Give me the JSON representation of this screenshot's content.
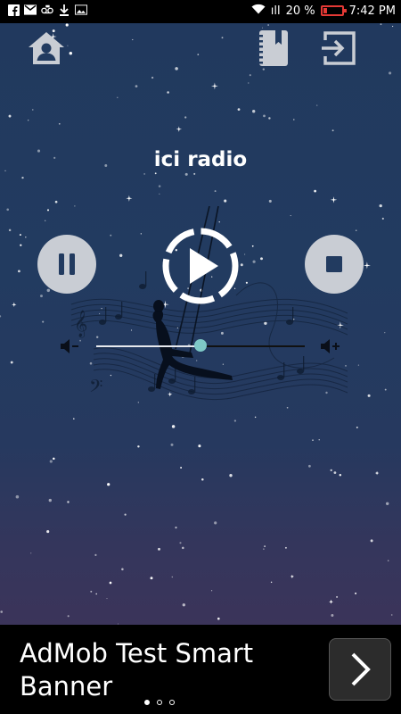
{
  "status_bar": {
    "signal_text": "ıll",
    "battery_percent": "20",
    "percent_sign": "%",
    "battery_level": 0.2,
    "time": "7:42 PM",
    "notification_icons": [
      "facebook-icon",
      "gmail-icon",
      "voicemail-icon",
      "download-icon",
      "image-icon"
    ]
  },
  "toolbar": {
    "home_icon": "home-profile-icon",
    "notes_icon": "notebook-icon",
    "exit_icon": "exit-icon"
  },
  "player": {
    "station_name": "ici radio",
    "volume_level": 0.5
  },
  "ad": {
    "text": "AdMob Test Smart Banner",
    "dots": [
      true,
      false,
      false
    ]
  },
  "colors": {
    "background_top": "#21395e",
    "background_bottom": "#3b345a",
    "button_gray": "#c9cdd4",
    "slider_thumb": "#7ec9c7",
    "battery_red": "#e53935"
  }
}
